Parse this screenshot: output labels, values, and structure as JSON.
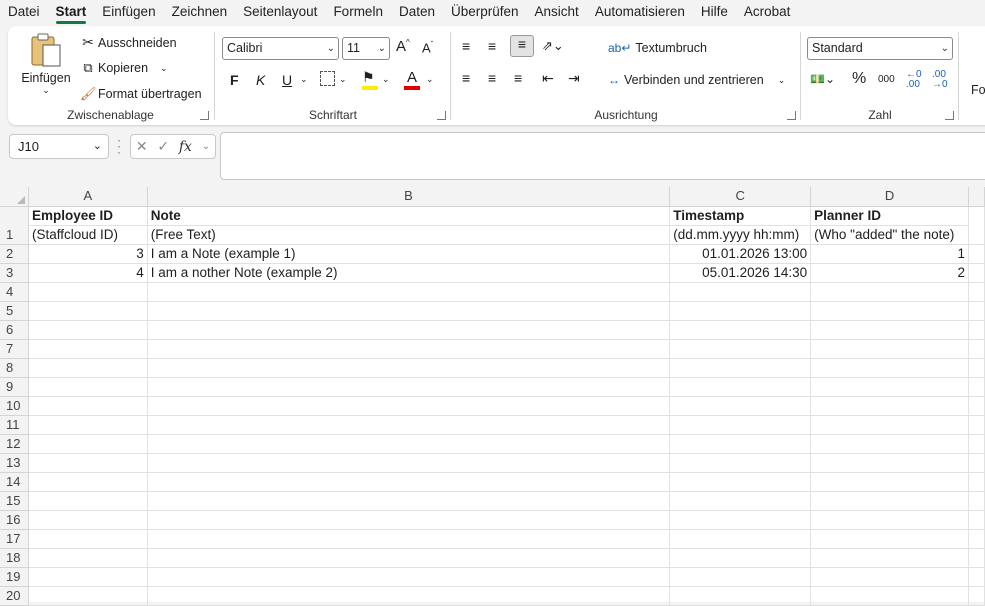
{
  "menu": [
    "Datei",
    "Start",
    "Einfügen",
    "Zeichnen",
    "Seitenlayout",
    "Formeln",
    "Daten",
    "Überprüfen",
    "Ansicht",
    "Automatisieren",
    "Hilfe",
    "Acrobat"
  ],
  "ribbon": {
    "clipboard": {
      "paste": "Einfügen",
      "cut": "Ausschneiden",
      "copy": "Kopieren",
      "format_painter": "Format übertragen",
      "label": "Zwischenablage"
    },
    "font": {
      "family": "Calibri",
      "size": "11",
      "bold": "F",
      "italic": "K",
      "underline": "U",
      "font_color_letter": "A",
      "label": "Schriftart"
    },
    "alignment": {
      "wrap": "Textumbruch",
      "merge": "Verbinden und zentrieren",
      "label": "Ausrichtung"
    },
    "number": {
      "format": "Standard",
      "percent": "%",
      "thousands": "000",
      "label": "Zahl"
    },
    "next_group_fragment": "Fo"
  },
  "formula_bar": {
    "name_box": "J10",
    "fx": "fx",
    "content": ""
  },
  "sheet": {
    "columns": [
      "A",
      "B",
      "C",
      "D"
    ],
    "rows": [
      {
        "n": "1",
        "a": "Employee ID",
        "b": "Note",
        "c": "Timestamp",
        "d": "Planner ID"
      },
      {
        "n": "",
        "a": "(Staffcloud ID)",
        "b": "(Free Text)",
        "c": "(dd.mm.yyyy hh:mm)",
        "d": "(Who \"added\" the note)"
      },
      {
        "n": "2",
        "a": "3",
        "b": "I am a Note (example 1)",
        "c": "01.01.2026 13:00",
        "d": "1"
      },
      {
        "n": "3",
        "a": "4",
        "b": "I am a nother Note (example 2)",
        "c": "05.01.2026 14:30",
        "d": "2"
      }
    ],
    "empty_rows": [
      "4",
      "5",
      "6",
      "7",
      "8",
      "9",
      "10",
      "11",
      "12",
      "13",
      "14",
      "15",
      "16",
      "17",
      "18",
      "19",
      "20"
    ]
  }
}
